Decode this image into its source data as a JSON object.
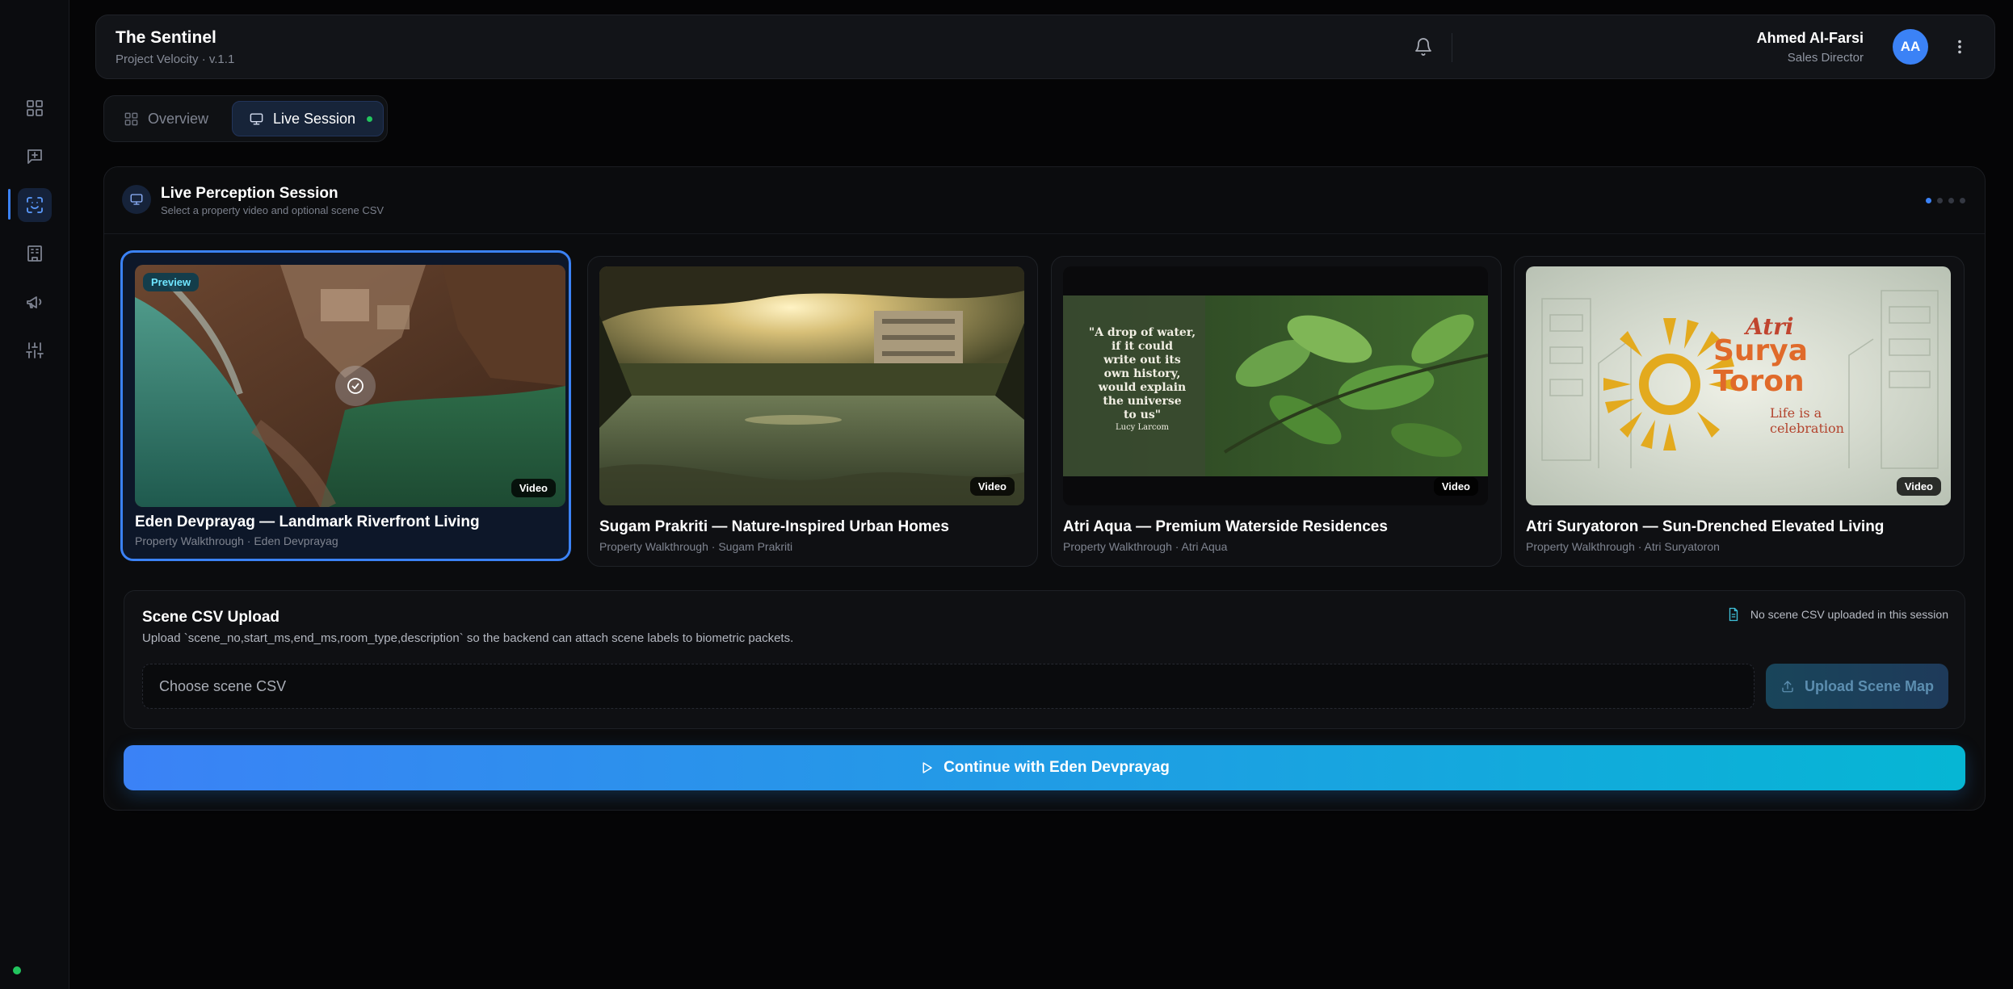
{
  "app": {
    "title": "The Sentinel",
    "subtitle": "Project Velocity · v.1.1"
  },
  "user": {
    "name": "Ahmed Al-Farsi",
    "role": "Sales Director",
    "initials": "AA"
  },
  "sidebar": {
    "items": [
      {
        "icon": "dashboard-grid-icon"
      },
      {
        "icon": "message-plus-icon"
      },
      {
        "icon": "scan-face-icon",
        "active": true
      },
      {
        "icon": "building-icon"
      },
      {
        "icon": "megaphone-icon"
      },
      {
        "icon": "sliders-icon"
      }
    ]
  },
  "tabs": [
    {
      "label": "Overview",
      "icon": "grid-icon"
    },
    {
      "label": "Live Session",
      "icon": "monitor-icon",
      "active": true
    }
  ],
  "session": {
    "title": "Live Perception Session",
    "subtitle": "Select a property video and optional scene CSV",
    "pages": 4,
    "current_page": 1
  },
  "cards": [
    {
      "title": "Eden Devprayag — Landmark Riverfront Living",
      "subtitle": "Property Walkthrough · Eden Devprayag",
      "badge": "Video",
      "preview_label": "Preview",
      "selected": true
    },
    {
      "title": "Sugam Prakriti — Nature-Inspired Urban Homes",
      "subtitle": "Property Walkthrough · Sugam Prakriti",
      "badge": "Video"
    },
    {
      "title": "Atri Aqua — Premium Waterside Residences",
      "subtitle": "Property Walkthrough · Atri Aqua",
      "badge": "Video",
      "quote": [
        "\"A drop of water,",
        "if it could",
        "write out its",
        "own history,",
        "would explain",
        "the universe",
        "to us\""
      ],
      "quote_author": "Lucy Larcom"
    },
    {
      "title": "Atri Suryatoron — Sun-Drenched Elevated Living",
      "subtitle": "Property Walkthrough · Atri Suryatoron",
      "badge": "Video",
      "logo": {
        "brand": "Atri",
        "name1": "Surya",
        "name2": "Toron",
        "tagline1": "Life is a",
        "tagline2": "celebration"
      }
    }
  ],
  "csv": {
    "title": "Scene CSV Upload",
    "description": "Upload `scene_no,start_ms,end_ms,room_type,description` so the backend can attach scene labels to biometric packets.",
    "status": "No scene CSV uploaded in this session",
    "input_placeholder": "Choose scene CSV",
    "upload_label": "Upload Scene Map"
  },
  "continue_label": "Continue with Eden Devprayag",
  "colors": {
    "accent": "#3b82f6",
    "accent_end": "#06b6d4",
    "live": "#22c55e",
    "background": "#050506"
  }
}
